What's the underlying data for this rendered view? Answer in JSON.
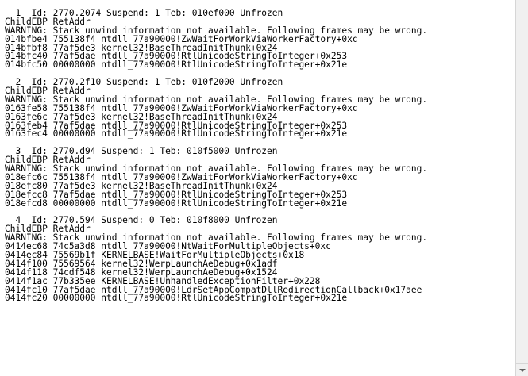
{
  "threads": [
    {
      "header": "  1  Id: 2770.2074 Suspend: 1 Teb: 010ef000 Unfrozen",
      "columns": "ChildEBP RetAddr",
      "warning": "WARNING: Stack unwind information not available. Following frames may be wrong.",
      "frames": [
        "014bfbe4 755138f4 ntdll_77a90000!ZwWaitForWorkViaWorkerFactory+0xc",
        "014bfbf8 77af5de3 kernel32!BaseThreadInitThunk+0x24",
        "014bfc40 77af5dae ntdll_77a90000!RtlUnicodeStringToInteger+0x253",
        "014bfc50 00000000 ntdll_77a90000!RtlUnicodeStringToInteger+0x21e"
      ]
    },
    {
      "header": "  2  Id: 2770.2f10 Suspend: 1 Teb: 010f2000 Unfrozen",
      "columns": "ChildEBP RetAddr",
      "warning": "WARNING: Stack unwind information not available. Following frames may be wrong.",
      "frames": [
        "0163fe58 755138f4 ntdll_77a90000!ZwWaitForWorkViaWorkerFactory+0xc",
        "0163fe6c 77af5de3 kernel32!BaseThreadInitThunk+0x24",
        "0163feb4 77af5dae ntdll_77a90000!RtlUnicodeStringToInteger+0x253",
        "0163fec4 00000000 ntdll_77a90000!RtlUnicodeStringToInteger+0x21e"
      ]
    },
    {
      "header": "  3  Id: 2770.d94 Suspend: 1 Teb: 010f5000 Unfrozen",
      "columns": "ChildEBP RetAddr",
      "warning": "WARNING: Stack unwind information not available. Following frames may be wrong.",
      "frames": [
        "018efc6c 755138f4 ntdll_77a90000!ZwWaitForWorkViaWorkerFactory+0xc",
        "018efc80 77af5de3 kernel32!BaseThreadInitThunk+0x24",
        "018efcc8 77af5dae ntdll_77a90000!RtlUnicodeStringToInteger+0x253",
        "018efcd8 00000000 ntdll_77a90000!RtlUnicodeStringToInteger+0x21e"
      ]
    },
    {
      "header": "  4  Id: 2770.594 Suspend: 0 Teb: 010f8000 Unfrozen",
      "columns": "ChildEBP RetAddr",
      "warning": "WARNING: Stack unwind information not available. Following frames may be wrong.",
      "frames": [
        "0414ec68 74c5a3d8 ntdll_77a90000!NtWaitForMultipleObjects+0xc",
        "0414ec84 75569b1f KERNELBASE!WaitForMultipleObjects+0x18",
        "0414f100 75569564 kernel32!WerpLaunchAeDebug+0x1adf",
        "0414f118 74cdf548 kernel32!WerpLaunchAeDebug+0x1524",
        "0414f1ac 77b335ee KERNELBASE!UnhandledExceptionFilter+0x228",
        "0414fc10 77af5dae ntdll_77a90000!LdrSetAppCompatDllRedirectionCallback+0x17aee",
        "0414fc20 00000000 ntdll_77a90000!RtlUnicodeStringToInteger+0x21e"
      ]
    }
  ]
}
